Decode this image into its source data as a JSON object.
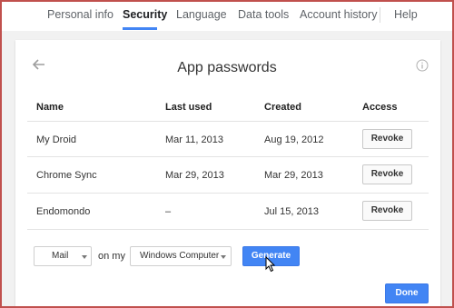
{
  "nav": {
    "tabs": [
      {
        "label": "Personal info"
      },
      {
        "label": "Security"
      },
      {
        "label": "Language"
      },
      {
        "label": "Data tools"
      },
      {
        "label": "Account history"
      },
      {
        "label": "Help"
      }
    ]
  },
  "dialog": {
    "title": "App passwords",
    "columns": {
      "name": "Name",
      "last_used": "Last used",
      "created": "Created",
      "access": "Access"
    },
    "rows": [
      {
        "name": "My Droid",
        "last_used": "Mar 11, 2013",
        "created": "Aug 19, 2012",
        "action": "Revoke"
      },
      {
        "name": "Chrome Sync",
        "last_used": "Mar 29, 2013",
        "created": "Mar 29, 2013",
        "action": "Revoke"
      },
      {
        "name": "Endomondo",
        "last_used": "–",
        "created": "Jul 15, 2013",
        "action": "Revoke"
      }
    ],
    "generator": {
      "app_select": "Mail",
      "on_my": "on my",
      "device_select": "Windows Computer",
      "generate_label": "Generate"
    },
    "done_label": "Done"
  },
  "colors": {
    "accent": "#4285f4",
    "frame": "#c0504d"
  },
  "icons": {
    "back": "arrow-left-icon",
    "info": "info-icon",
    "cursor": "mouse-pointer-icon"
  }
}
